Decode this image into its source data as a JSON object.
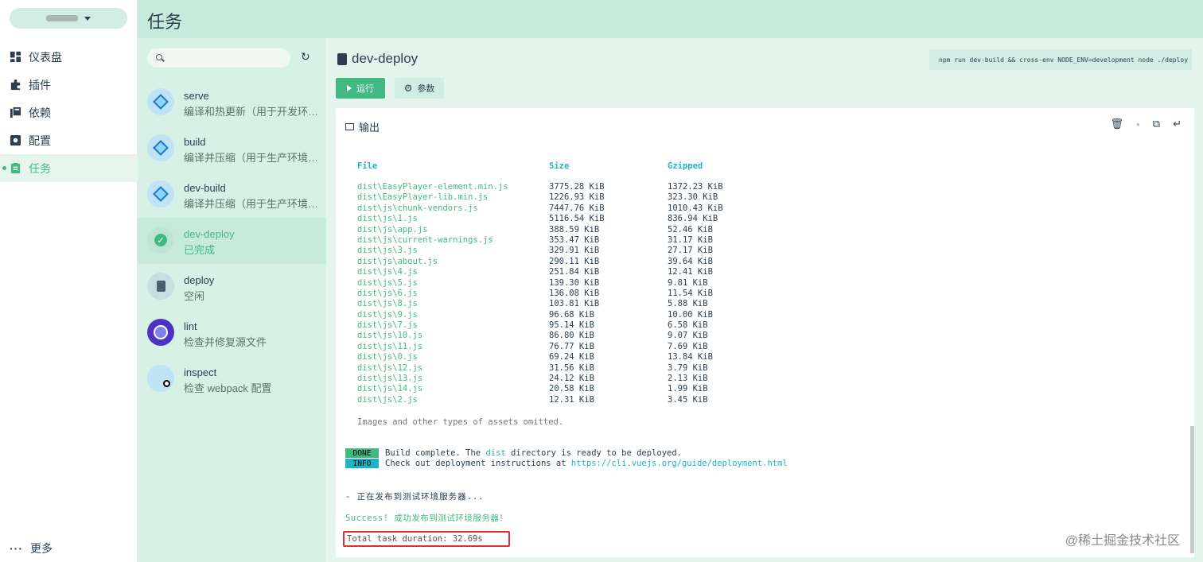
{
  "nav": {
    "items": [
      {
        "label": "仪表盘",
        "icon": "dashboard-icon"
      },
      {
        "label": "插件",
        "icon": "puzzle-icon"
      },
      {
        "label": "依赖",
        "icon": "library-icon"
      },
      {
        "label": "配置",
        "icon": "settings-icon"
      },
      {
        "label": "任务",
        "icon": "clipboard-icon",
        "active": true
      }
    ],
    "more_label": "更多"
  },
  "header": {
    "title": "任务"
  },
  "tasks": [
    {
      "name": "serve",
      "desc": "编译和热更新（用于开发环…",
      "status": "webpack"
    },
    {
      "name": "build",
      "desc": "编译并压缩（用于生产环境…",
      "status": "webpack"
    },
    {
      "name": "dev-build",
      "desc": "编译并压缩（用于生产环境…",
      "status": "webpack"
    },
    {
      "name": "dev-deploy",
      "desc": "已完成",
      "status": "done"
    },
    {
      "name": "deploy",
      "desc": "空闲",
      "status": "idle"
    },
    {
      "name": "lint",
      "desc": "检查并修复源文件",
      "status": "lint"
    },
    {
      "name": "inspect",
      "desc": "检查 webpack 配置",
      "status": "inspect"
    }
  ],
  "main": {
    "task_title": "dev-deploy",
    "command": "npm run dev-build && cross-env NODE_ENV=development node ./deploy",
    "run_label": "运行",
    "params_label": "参数",
    "output_label": "输出"
  },
  "output": {
    "headers": {
      "file": "File",
      "size": "Size",
      "gzipped": "Gzipped"
    },
    "rows": [
      {
        "file": "dist\\EasyPlayer-element.min.js",
        "size": "3775.28 KiB",
        "gz": "1372.23 KiB"
      },
      {
        "file": "dist\\EasyPlayer-lib.min.js",
        "size": "1226.93 KiB",
        "gz": "323.30 KiB"
      },
      {
        "file": "dist\\js\\chunk-vendors.js",
        "size": "7447.76 KiB",
        "gz": "1010.43 KiB"
      },
      {
        "file": "dist\\js\\1.js",
        "size": "5116.54 KiB",
        "gz": "836.94 KiB"
      },
      {
        "file": "dist\\js\\app.js",
        "size": "388.59 KiB",
        "gz": "52.46 KiB"
      },
      {
        "file": "dist\\js\\current-warnings.js",
        "size": "353.47 KiB",
        "gz": "31.17 KiB"
      },
      {
        "file": "dist\\js\\3.js",
        "size": "329.91 KiB",
        "gz": "27.17 KiB"
      },
      {
        "file": "dist\\js\\about.js",
        "size": "290.11 KiB",
        "gz": "39.64 KiB"
      },
      {
        "file": "dist\\js\\4.js",
        "size": "251.84 KiB",
        "gz": "12.41 KiB"
      },
      {
        "file": "dist\\js\\5.js",
        "size": "139.30 KiB",
        "gz": "9.81 KiB"
      },
      {
        "file": "dist\\js\\6.js",
        "size": "136.08 KiB",
        "gz": "11.54 KiB"
      },
      {
        "file": "dist\\js\\8.js",
        "size": "103.81 KiB",
        "gz": "5.88 KiB"
      },
      {
        "file": "dist\\js\\9.js",
        "size": "96.68 KiB",
        "gz": "10.00 KiB"
      },
      {
        "file": "dist\\js\\7.js",
        "size": "95.14 KiB",
        "gz": "6.58 KiB"
      },
      {
        "file": "dist\\js\\10.js",
        "size": "86.80 KiB",
        "gz": "9.07 KiB"
      },
      {
        "file": "dist\\js\\11.js",
        "size": "76.77 KiB",
        "gz": "7.69 KiB"
      },
      {
        "file": "dist\\js\\0.js",
        "size": "69.24 KiB",
        "gz": "13.84 KiB"
      },
      {
        "file": "dist\\js\\12.js",
        "size": "31.56 KiB",
        "gz": "3.79 KiB"
      },
      {
        "file": "dist\\js\\13.js",
        "size": "24.12 KiB",
        "gz": "2.13 KiB"
      },
      {
        "file": "dist\\js\\14.js",
        "size": "20.58 KiB",
        "gz": "1.99 KiB"
      },
      {
        "file": "dist\\js\\2.js",
        "size": "12.31 KiB",
        "gz": "3.45 KiB"
      }
    ],
    "omitted": "Images and other types of assets omitted.",
    "done_badge": "DONE",
    "info_badge": "INFO",
    "done_pre": "Build complete. The ",
    "done_dir": "dist",
    "done_post": " directory is ready to be deployed.",
    "info_pre": "Check out deployment instructions at ",
    "info_link": "https://cli.vuejs.org/guide/deployment.html",
    "deploying": "- 正在发布到测试环境服务器...",
    "success": "Success! 成功发布到测试环境服务器！",
    "duration": "Total task duration: 32.69s"
  },
  "watermark": "@稀土掘金技术社区",
  "colors": {
    "accent": "#42b983",
    "info": "#1eb4c8",
    "highlight_border": "#e0302f"
  }
}
